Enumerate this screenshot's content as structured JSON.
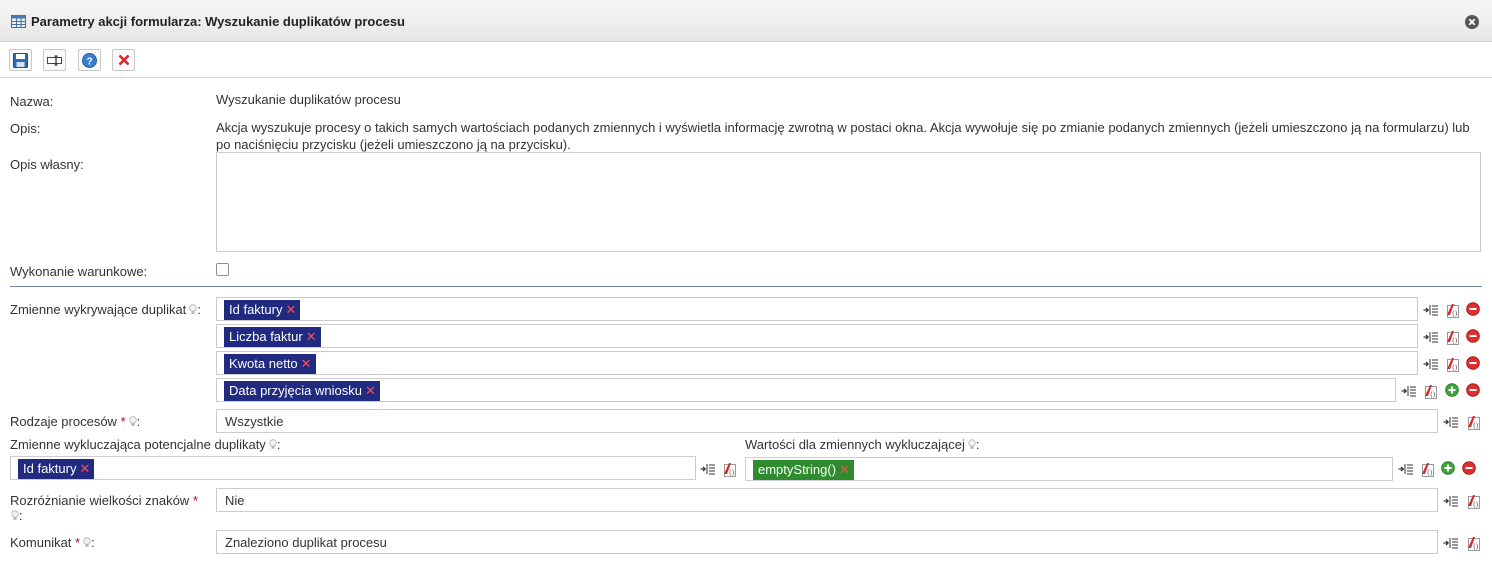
{
  "dialog": {
    "title": "Parametry akcji formularza: Wyszukanie duplikatów procesu"
  },
  "toolbar": {
    "buttons": [
      {
        "name": "save",
        "icon": "floppy-disk-icon"
      },
      {
        "name": "display",
        "icon": "text-field-icon"
      },
      {
        "name": "help",
        "icon": "help-icon"
      },
      {
        "name": "cancel",
        "icon": "red-x-icon"
      }
    ]
  },
  "form": {
    "name_label": "Nazwa:",
    "name_value": "Wyszukanie duplikatów procesu",
    "description_label": "Opis:",
    "description_value": "Akcja wyszukuje procesy o takich samych wartościach podanych zmiennych i wyświetla informację zwrotną w postaci okna. Akcja wywołuje się po zmianie podanych zmiennych (jeżeli umieszczono ją na formularzu) lub po naciśnięciu przycisku (jeżeli umieszczono ją na przycisku).",
    "own_description_label": "Opis własny:",
    "own_description_value": "",
    "conditional_label": "Wykonanie warunkowe:",
    "conditional_checked": false,
    "detect_vars_label": "Zmienne wykrywające duplikat",
    "detect_vars": [
      "Id faktury",
      "Liczba faktur",
      "Kwota netto",
      "Data przyjęcia wniosku"
    ],
    "process_types_label": "Rodzaje procesów",
    "process_types_value": "Wszystkie",
    "exclude_vars_label": "Zmienne wykluczająca potencjalne duplikaty",
    "exclude_vars": [
      "Id faktury"
    ],
    "exclude_values_label": "Wartości dla zmiennych wykluczającej",
    "exclude_values": [
      "emptyString()"
    ],
    "case_label_line1": "Rozróżnianie wielkości znaków",
    "case_value": "Nie",
    "message_label": "Komunikat",
    "message_value": "Znaleziono duplikat procesu",
    "colon": ":",
    "required_mark": "*",
    "chip_remove": "✕"
  },
  "colors": {
    "chip_blue": "#1f2a80",
    "chip_green": "#2e8b2e",
    "divider": "#6b88a8",
    "required": "#cc0000"
  }
}
